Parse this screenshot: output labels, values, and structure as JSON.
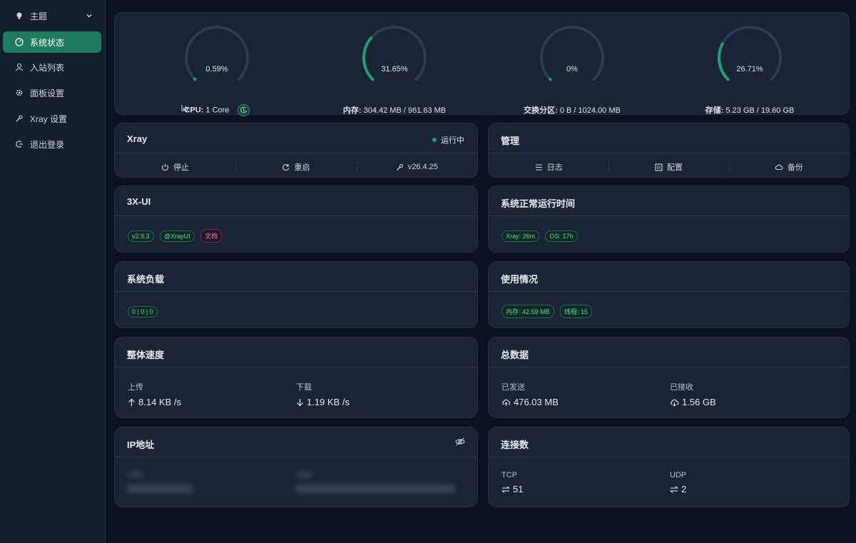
{
  "sidebar": {
    "items": [
      {
        "label": "主题",
        "icon": "bulb-icon"
      },
      {
        "label": "系统状态",
        "icon": "dashboard-icon"
      },
      {
        "label": "入站列表",
        "icon": "user-icon"
      },
      {
        "label": "面板设置",
        "icon": "gear-icon"
      },
      {
        "label": "Xray 设置",
        "icon": "wrench-icon"
      },
      {
        "label": "退出登录",
        "icon": "logout-icon"
      }
    ]
  },
  "gauges": [
    {
      "pct_text": "0.59%",
      "value": 0.59,
      "label_key": "CPU:",
      "label_val": "1 Core"
    },
    {
      "pct_text": "31.65%",
      "value": 31.65,
      "label_key": "内存:",
      "label_val": "304.42 MB / 961.63 MB"
    },
    {
      "pct_text": "0%",
      "value": 0,
      "label_key": "交换分区:",
      "label_val": "0 B / 1024.00 MB"
    },
    {
      "pct_text": "26.71%",
      "value": 26.71,
      "label_key": "存储:",
      "label_val": "5.23 GB / 19.60 GB"
    }
  ],
  "xray": {
    "title": "Xray",
    "status": "运行中",
    "stop": "停止",
    "restart": "重启",
    "version": "v26.4.25"
  },
  "manage": {
    "title": "管理",
    "logs": "日志",
    "config": "配置",
    "backup": "备份"
  },
  "ui3x": {
    "title": "3X-UI",
    "tags": [
      "v2.9.3",
      "@XrayUI",
      "文档"
    ]
  },
  "uptime": {
    "title": "系统正常运行时间",
    "tags": [
      "Xray: 26m",
      "OS: 17h"
    ]
  },
  "load": {
    "title": "系统负载",
    "tags": [
      "0 | 0 | 0"
    ]
  },
  "usage": {
    "title": "使用情况",
    "tags": [
      "内存: 42.59 MB",
      "线程: 15"
    ]
  },
  "speed": {
    "title": "整体速度",
    "up_label": "上传",
    "up_value": "8.14 KB /s",
    "down_label": "下载",
    "down_value": "1.19 KB /s"
  },
  "total": {
    "title": "总数据",
    "sent_label": "已发送",
    "sent_value": "476.03 MB",
    "recv_label": "已接收",
    "recv_value": "1.56 GB"
  },
  "ip": {
    "title": "IP地址"
  },
  "conn": {
    "title": "连接数",
    "tcp_label": "TCP",
    "tcp_value": "51",
    "udp_label": "UDP",
    "udp_value": "2"
  },
  "colors": {
    "accent": "#1f9e74",
    "track": "#2e3b52"
  }
}
